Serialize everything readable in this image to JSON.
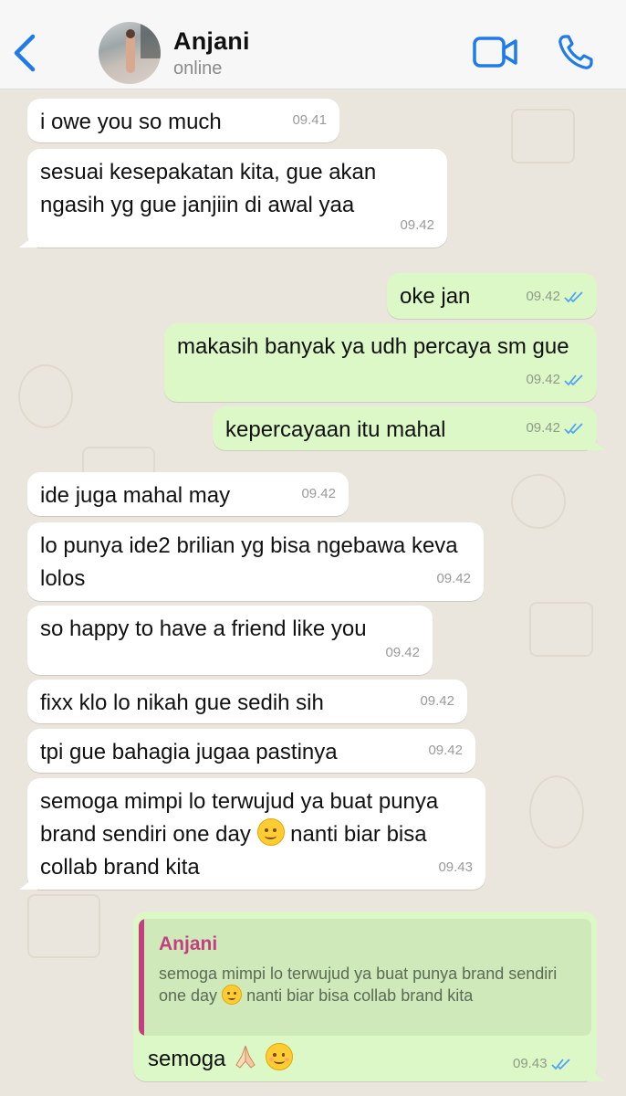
{
  "header": {
    "contact_name": "Anjani",
    "status": "online",
    "icons": [
      "back-chevron-icon",
      "video-call-icon",
      "phone-call-icon"
    ],
    "accent_color": "#1f7aec"
  },
  "messages": [
    {
      "dir": "in",
      "text": "i owe you so much",
      "time": "09.41"
    },
    {
      "dir": "in",
      "text": "sesuai kesepakatan kita, gue akan ngasih yg gue janjiin di awal yaa",
      "time": "09.42"
    },
    {
      "dir": "out",
      "text": "oke jan",
      "time": "09.42",
      "read": true
    },
    {
      "dir": "out",
      "text": "makasih banyak ya udh percaya sm gue",
      "time": "09.42",
      "read": true
    },
    {
      "dir": "out",
      "text": "kepercayaan itu mahal",
      "time": "09.42",
      "read": true
    },
    {
      "dir": "in",
      "text": "ide juga mahal may",
      "time": "09.42"
    },
    {
      "dir": "in",
      "text": "lo punya ide2 brilian yg bisa ngebawa keva lolos",
      "time": "09.42"
    },
    {
      "dir": "in",
      "text": "so happy to have a friend like you",
      "time": "09.42"
    },
    {
      "dir": "in",
      "text": "fixx klo lo nikah gue sedih sih",
      "time": "09.42"
    },
    {
      "dir": "in",
      "text": "tpi gue bahagia jugaa pastinya",
      "time": "09.42"
    },
    {
      "dir": "in",
      "text_a": "semoga mimpi lo terwujud ya buat punya brand sendiri one day",
      "emoji": "smiling-face",
      "text_b": "nanti biar bisa collab brand kita",
      "time": "09.43"
    },
    {
      "dir": "out",
      "quote": {
        "author": "Anjani",
        "text_a": "semoga mimpi lo terwujud ya buat punya brand sendiri one day",
        "emoji": "smiling-face",
        "text_b": "nanti biar bisa collab brand kita"
      },
      "text": "semoga",
      "emojis": [
        "folded-hands",
        "smiling-face-blush"
      ],
      "time": "09.43",
      "read": true
    }
  ],
  "colors": {
    "incoming_bubble": "#ffffff",
    "outgoing_bubble": "#dcf8c6",
    "read_tick": "#4fa3f7",
    "quote_author": "#c2407f",
    "chat_background": "#ebe6dd"
  }
}
